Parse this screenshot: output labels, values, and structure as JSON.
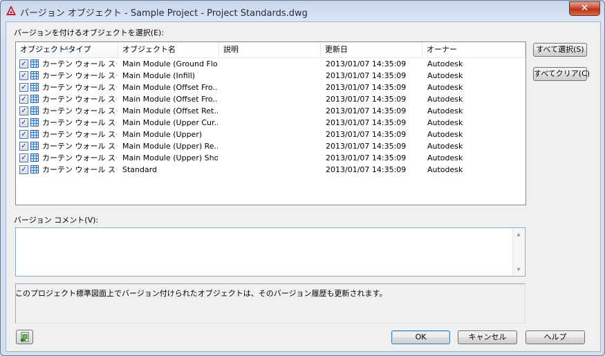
{
  "window": {
    "title": "バージョン オブジェクト - Sample Project - Project Standards.dwg",
    "close_glyph": "✕"
  },
  "objects_label": "バージョンを付けるオブジェクトを選択(E):",
  "columns": [
    "オブジェクト タイプ",
    "オブジェクト名",
    "説明",
    "更新日",
    "オーナー"
  ],
  "rows": [
    {
      "type": "カーテン ウォール スタ...",
      "name": "Main Module (Ground Flo...",
      "desc": "",
      "date": "2013/01/07 14:35:09",
      "owner": "Autodesk",
      "checked": true
    },
    {
      "type": "カーテン ウォール スタ...",
      "name": "Main Module (Infill)",
      "desc": "",
      "date": "2013/01/07 14:35:09",
      "owner": "Autodesk",
      "checked": true
    },
    {
      "type": "カーテン ウォール スタ...",
      "name": "Main Module (Offset Fro...",
      "desc": "",
      "date": "2013/01/07 14:35:09",
      "owner": "Autodesk",
      "checked": true
    },
    {
      "type": "カーテン ウォール スタ...",
      "name": "Main Module (Offset Fro...",
      "desc": "",
      "date": "2013/01/07 14:35:09",
      "owner": "Autodesk",
      "checked": true
    },
    {
      "type": "カーテン ウォール スタ...",
      "name": "Main Module (Offset Ret...",
      "desc": "",
      "date": "2013/01/07 14:35:09",
      "owner": "Autodesk",
      "checked": true
    },
    {
      "type": "カーテン ウォール スタ...",
      "name": "Main Module (Upper Cur...",
      "desc": "",
      "date": "2013/01/07 14:35:09",
      "owner": "Autodesk",
      "checked": true
    },
    {
      "type": "カーテン ウォール スタ...",
      "name": "Main Module (Upper)",
      "desc": "",
      "date": "2013/01/07 14:35:09",
      "owner": "Autodesk",
      "checked": true
    },
    {
      "type": "カーテン ウォール スタ...",
      "name": "Main Module (Upper) Re...",
      "desc": "",
      "date": "2013/01/07 14:35:09",
      "owner": "Autodesk",
      "checked": true
    },
    {
      "type": "カーテン ウォール スタ...",
      "name": "Main Module (Upper) Sho...",
      "desc": "",
      "date": "2013/01/07 14:35:09",
      "owner": "Autodesk",
      "checked": true
    },
    {
      "type": "カーテン ウォール スタ...",
      "name": "Standard",
      "desc": "",
      "date": "2013/01/07 14:35:09",
      "owner": "Autodesk",
      "checked": true
    }
  ],
  "buttons": {
    "select_all": "すべて選択(S)",
    "clear_all": "すべてクリア(C)",
    "ok": "OK",
    "cancel": "キャンセル",
    "help": "ヘルプ"
  },
  "comment_label": "バージョン コメント(V):",
  "comment_value": "",
  "info_text": "このプロジェクト標準図面上でバージョン付けられたオブジェクトは、そのバージョン履歴も更新されます。",
  "icons": {
    "app": "autocad-logo-icon",
    "check": "✓",
    "row_icon": "curtain-wall-style-icon",
    "bottom_button": "refresh-drawing-icon"
  }
}
